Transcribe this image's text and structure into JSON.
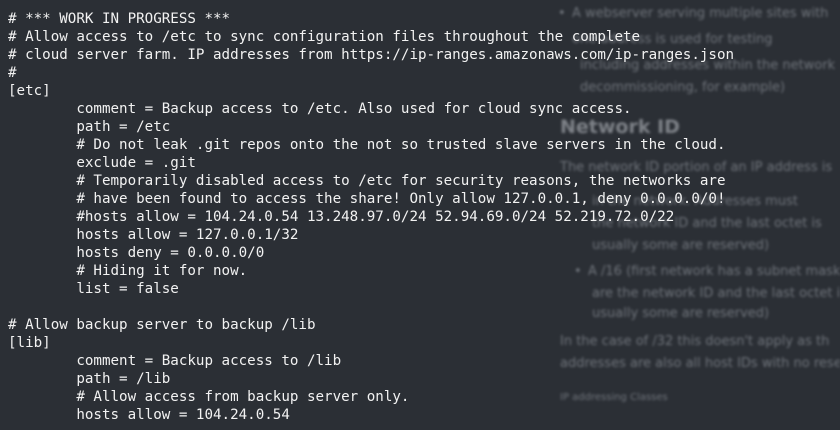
{
  "terminal": {
    "lines": [
      "# *** WORK IN PROGRESS ***",
      "# Allow access to /etc to sync configuration files throughout the complete",
      "# cloud server farm. IP addresses from https://ip-ranges.amazonaws.com/ip-ranges.json",
      "#",
      "[etc]",
      "        comment = Backup access to /etc. Also used for cloud sync access.",
      "        path = /etc",
      "        # Do not leak .git repos onto the not so trusted slave servers in the cloud.",
      "        exclude = .git",
      "        # Temporarily disabled access to /etc for security reasons, the networks are",
      "        # have been found to access the share! Only allow 127.0.0.1, deny 0.0.0.0/0!",
      "        #hosts allow = 104.24.0.54 13.248.97.0/24 52.94.69.0/24 52.219.72.0/22",
      "        hosts allow = 127.0.0.1/32",
      "        hosts deny = 0.0.0.0/0",
      "        # Hiding it for now.",
      "        list = false",
      "",
      "# Allow backup server to backup /lib",
      "[lib]",
      "        comment = Backup access to /lib",
      "        path = /lib",
      "        # Allow access from backup server only.",
      "        hosts allow = 104.24.0.54"
    ]
  },
  "background_doc": {
    "bullet_1": "A webserver serving multiple sites with",
    "line_1": "one address is used for testing",
    "line_2": "including addresses within the network is",
    "line_3": "decommissioning, for example)",
    "heading": "Network ID",
    "line_4": "The network ID portion of an IP address is",
    "line_5": "in the network. Addresses must",
    "line_6": "the network ID and the last octet is",
    "line_7": "usually some are reserved)",
    "bullet_2": "A /16 (first network has a subnet mask",
    "line_8": "are the network ID and the last octet is",
    "line_9": "usually some are reserved)",
    "line_10": "In the case of /32 this doesn't apply as th",
    "line_11": "addresses are also all host IDs with no rese",
    "small_1": "IP addressing Classes"
  }
}
